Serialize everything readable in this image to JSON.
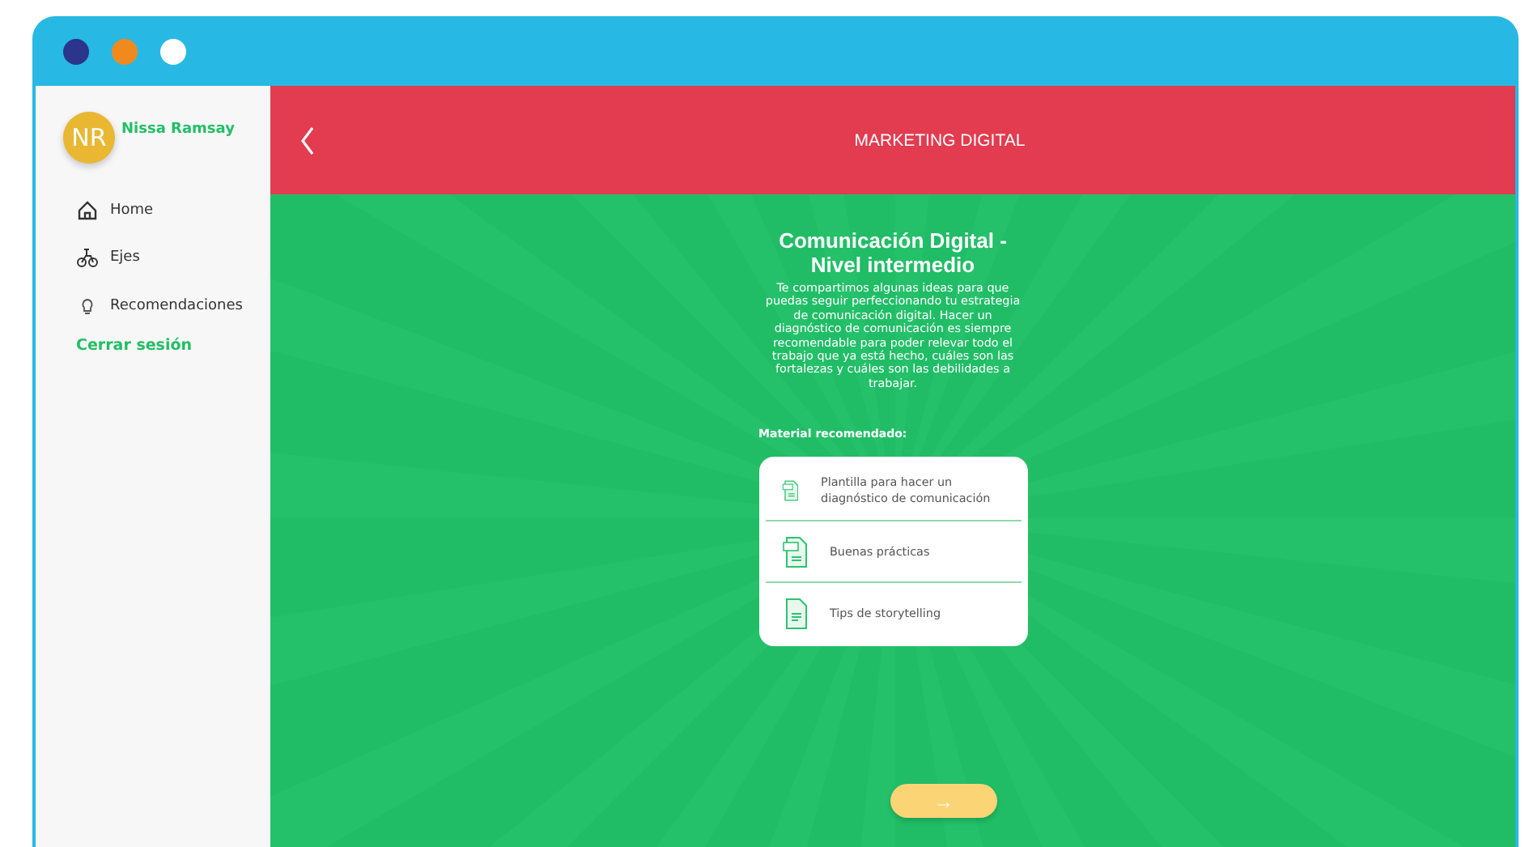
{
  "window": {
    "controls": [
      {
        "color": "#2b3589"
      },
      {
        "color": "#f18a1e"
      },
      {
        "color": "#ffffff"
      }
    ]
  },
  "sidebar": {
    "user": {
      "initials": "NR",
      "name": "Nissa Ramsay"
    },
    "items": [
      {
        "label": "Home",
        "kind": "home"
      },
      {
        "label": "Ejes",
        "kind": "bike"
      },
      {
        "label": "Recomendaciones",
        "kind": "bulb"
      }
    ],
    "logout": "Cerrar sesión"
  },
  "header": {
    "title": "MARKETING DIGITAL"
  },
  "content": {
    "title": "Comunicación Digital - Nivel intermedio",
    "body": "Te compartimos algunas ideas para que puedas seguir perfeccionando tu estrategia de comunicación digital. Hacer un diagnóstico de comunicación es siempre recomendable para poder relevar todo el trabajo que ya está hecho, cuáles son las fortalezas y cuáles son las debilidades a trabajar.",
    "material_label": "Material recomendado:",
    "materials": [
      {
        "label": "Plantilla para hacer un diagnóstico de comunicación",
        "kind": "pdf"
      },
      {
        "label": "Buenas prácticas",
        "kind": "pdf"
      },
      {
        "label": "Tips de storytelling",
        "kind": "doc"
      }
    ],
    "next_button": "→"
  }
}
